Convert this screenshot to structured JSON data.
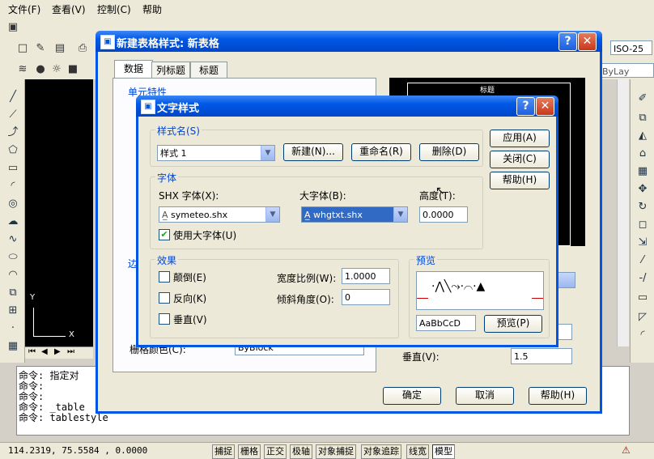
{
  "menubar": {
    "file": "文件(F)",
    "view": "查看(V)",
    "control": "控制(C)",
    "help": "帮助"
  },
  "topstrip": {
    "right_combo": "ISO-25",
    "bylayer": "ByLay"
  },
  "command": {
    "lines": [
      "命令: 指定对",
      "命令:",
      "命令:",
      "命令: _table",
      "命令: tablestyle"
    ]
  },
  "status": {
    "coords": "114.2319, 75.5584 , 0.0000",
    "buttons": [
      "捕捉",
      "栅格",
      "正交",
      "极轴",
      "对象捕捉",
      "对象追踪",
      "线宽",
      "模型"
    ]
  },
  "table_style_dialog": {
    "title": "新建表格样式: 新表格",
    "tabs": [
      "数据",
      "列标题",
      "标题"
    ],
    "cell_props": "单元特性",
    "border_label": "边",
    "grid_color_label": "栅格颜色(C):",
    "grid_color_value": "ByBlock",
    "preview_title": "标题",
    "vertical_label": "垂直(V):",
    "vertical_value": "1.5",
    "ok": "确定",
    "cancel": "取消",
    "help": "帮助(H)"
  },
  "text_style_dialog": {
    "title": "文字样式",
    "style_group": "样式名(S)",
    "style_value": "样式 1",
    "new_btn": "新建(N)...",
    "rename_btn": "重命名(R)",
    "delete_btn": "删除(D)",
    "font_group": "字体",
    "shx_label": "SHX 字体(X):",
    "shx_value": "symeteo.shx",
    "bigfont_label": "大字体(B):",
    "bigfont_value": "whgtxt.shx",
    "height_label": "高度(T):",
    "height_value": "0.0000",
    "use_bigfont": "使用大字体(U)",
    "effects_group": "效果",
    "upside_down": "颠倒(E)",
    "backwards": "反向(K)",
    "vertical": "垂直(V)",
    "width_label": "宽度比例(W):",
    "width_value": "1.0000",
    "oblique_label": "倾斜角度(O):",
    "oblique_value": "0",
    "preview_group": "预览",
    "preview_sample": "AaBbCcD",
    "preview_btn": "预览(P)",
    "apply_btn": "应用(A)",
    "close_btn": "关闭(C)",
    "help_btn": "帮助(H)"
  }
}
